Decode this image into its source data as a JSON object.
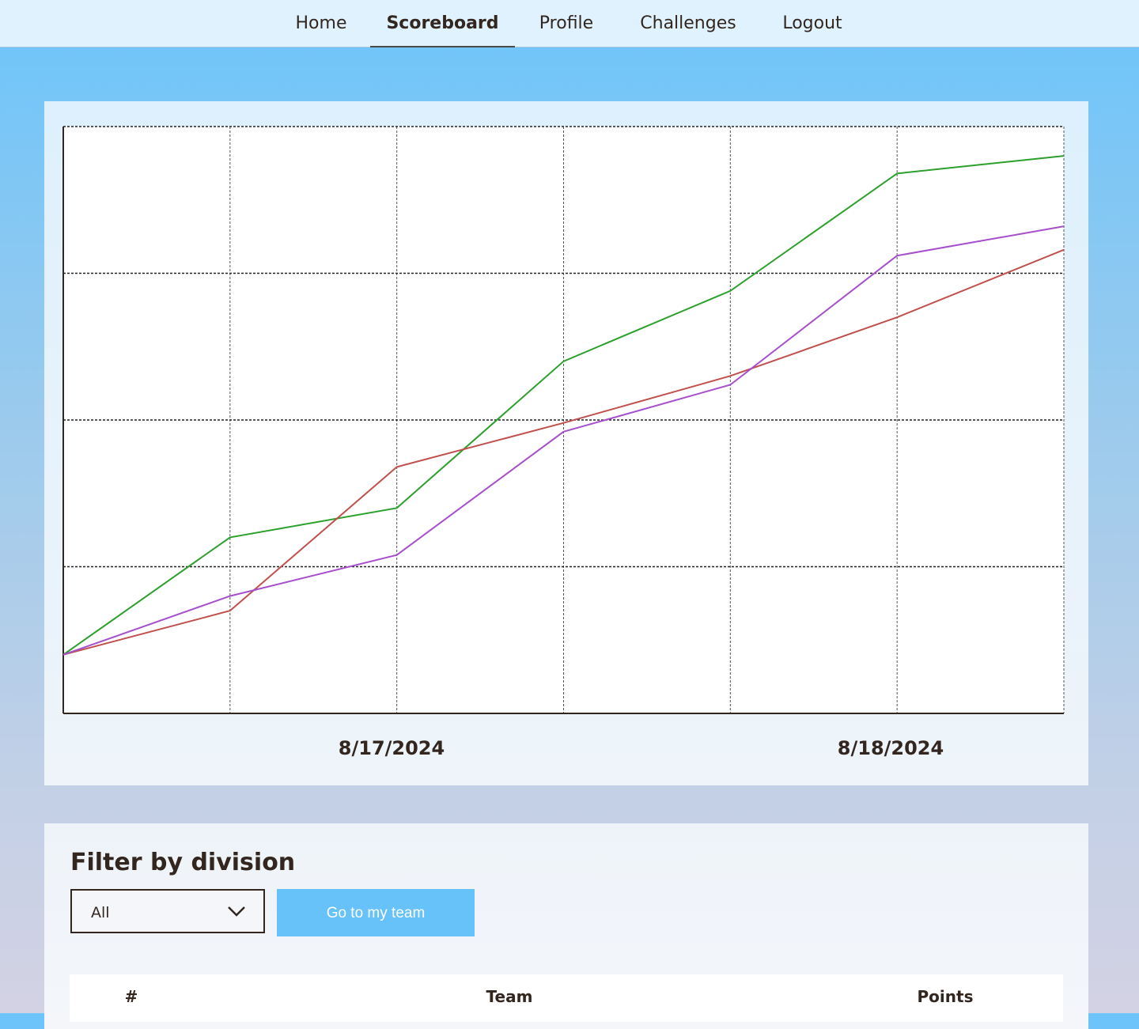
{
  "nav": {
    "items": [
      "Home",
      "Scoreboard",
      "Profile",
      "Challenges",
      "Logout"
    ],
    "active": "Scoreboard"
  },
  "chart_data": {
    "type": "line",
    "grid": true,
    "legend": "none",
    "x_tick_labels": [
      "8/17/2024",
      "8/18/2024"
    ],
    "series": [
      {
        "color": "#2ca02c",
        "values": [
          0.1,
          0.3,
          0.35,
          0.6,
          0.72,
          0.92,
          0.95
        ]
      },
      {
        "color": "#c0504d",
        "values": [
          0.1,
          0.175,
          0.42,
          0.495,
          0.575,
          0.675,
          0.79
        ]
      },
      {
        "color": "#a64fcc",
        "values": [
          0.1,
          0.2,
          0.27,
          0.48,
          0.56,
          0.78,
          0.83
        ]
      }
    ],
    "ylim": [
      0,
      1
    ],
    "y_gridlines": 4
  },
  "filter": {
    "title": "Filter by division",
    "selected": "All",
    "go_label": "Go to my team"
  },
  "table": {
    "headers": [
      "#",
      "Team",
      "Points"
    ]
  },
  "colors": {
    "sky": "#6cc4fa",
    "button": "#66c2f8",
    "nav_bg": "#dff2fe",
    "text": "#33261f"
  }
}
